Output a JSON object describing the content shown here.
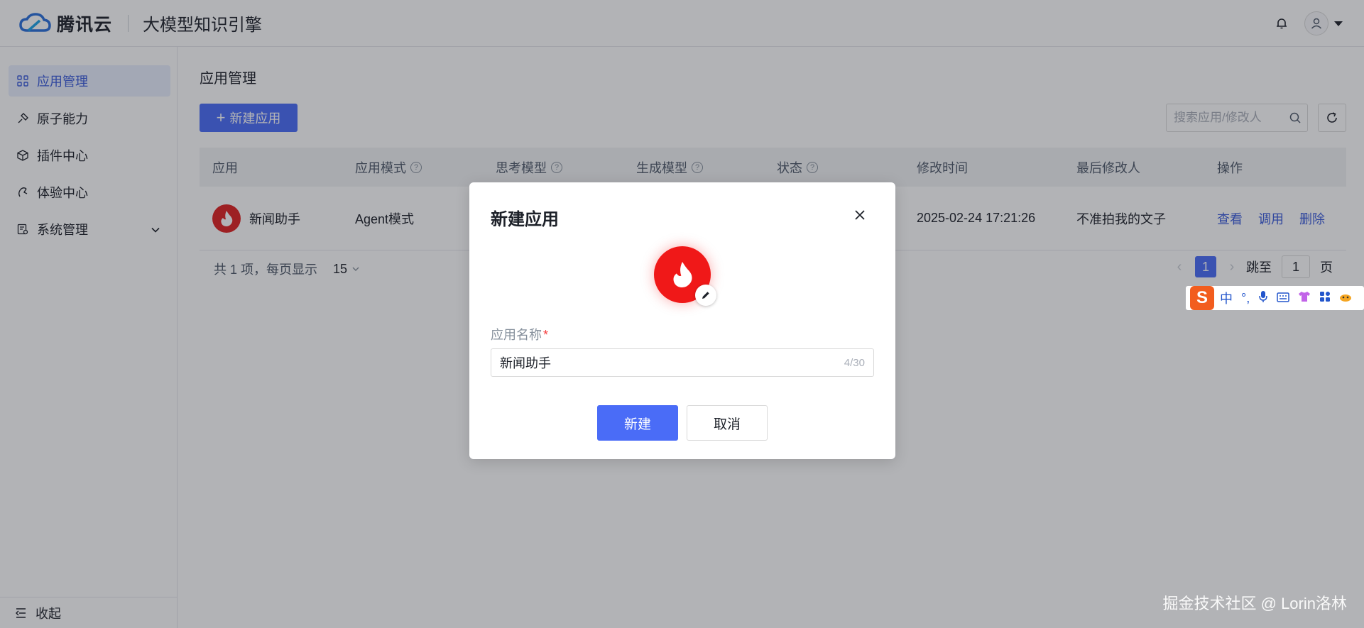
{
  "header": {
    "brand": "腾讯云",
    "product": "大模型知识引擎"
  },
  "sidebar": {
    "items": [
      {
        "label": "应用管理",
        "icon": "grid-icon",
        "active": true
      },
      {
        "label": "原子能力",
        "icon": "link-icon"
      },
      {
        "label": "插件中心",
        "icon": "cube-icon"
      },
      {
        "label": "体验中心",
        "icon": "experience-icon"
      },
      {
        "label": "系统管理",
        "icon": "settings-list-icon",
        "expandable": true
      }
    ],
    "collapse_label": "收起"
  },
  "main": {
    "title": "应用管理",
    "new_button": "新建应用",
    "search_placeholder": "搜索应用/修改人",
    "table": {
      "headers": [
        "应用",
        "应用模式",
        "思考模型",
        "生成模型",
        "状态",
        "修改时间",
        "最后修改人",
        "操作"
      ],
      "rows": [
        {
          "app": "新闻助手",
          "mode": "Agent模式",
          "modified_time": "2025-02-24 17:21:26",
          "modifier": "不准拍我的文子",
          "actions": [
            "查看",
            "调用",
            "删除"
          ]
        }
      ]
    },
    "pagination": {
      "total": "共 1 项，每页显示",
      "page_size": "15",
      "current_page": "1",
      "jump_label": "跳至",
      "jump_value": "1",
      "page_suffix": "页"
    }
  },
  "modal": {
    "title": "新建应用",
    "name_label": "应用名称",
    "required_mark": "*",
    "name_value": "新闻助手",
    "char_count": "4/30",
    "confirm_label": "新建",
    "cancel_label": "取消"
  },
  "ime": {
    "logo": "S",
    "lang": "中",
    "punct": "°,"
  },
  "watermark": "掘金技术社区 @ Lorin洛林",
  "colors": {
    "primary": "#4a6cf7",
    "link": "#3a5bdb",
    "avatar_red": "#f01818",
    "sidebar_active_bg": "#e8eefe"
  }
}
